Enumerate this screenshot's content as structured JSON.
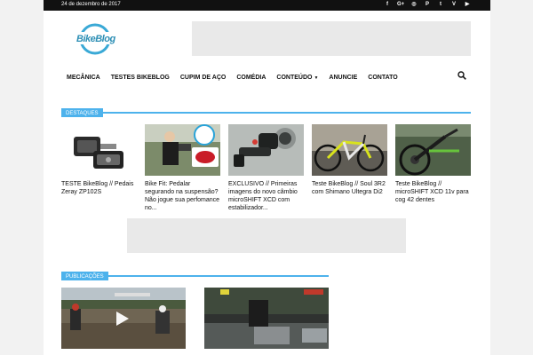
{
  "topbar": {
    "date": "24 de dezembro de 2017",
    "social_icons": [
      "facebook-icon",
      "google-plus-icon",
      "instagram-icon",
      "pinterest-icon",
      "twitter-icon",
      "vimeo-icon",
      "youtube-icon"
    ]
  },
  "logo": {
    "text": "BikeBlog"
  },
  "nav": {
    "items": [
      {
        "label": "MECÂNICA"
      },
      {
        "label": "TESTES BIKEBLOG"
      },
      {
        "label": "CUPIM DE AÇO"
      },
      {
        "label": "COMÉDIA"
      },
      {
        "label": "CONTEÚDO"
      },
      {
        "label": "ANUNCIE"
      },
      {
        "label": "CONTATO"
      }
    ]
  },
  "destaques": {
    "heading": "DESTAQUES",
    "posts": [
      {
        "title": "TESTE BikeBlog // Pedais Zeray ZP102S"
      },
      {
        "title": "Bike Fit: Pedalar segurando na suspensão? Não jogue sua perfomance no..."
      },
      {
        "title": "EXCLUSIVO // Primeiras imagens do novo câmbio microSHIFT XCD com estabilizador..."
      },
      {
        "title": "Teste BikeBlog // Soul 3R2 com Shimano Ultegra Di2"
      },
      {
        "title": "Teste BikeBlog // microSHIFT XCD 11v para cog 42 dentes"
      }
    ]
  },
  "publicacoes": {
    "heading": "PUBLICAÇÕES"
  },
  "colors": {
    "accent": "#4db2ec",
    "topbar": "#111111",
    "ad": "#e9e9e9"
  }
}
